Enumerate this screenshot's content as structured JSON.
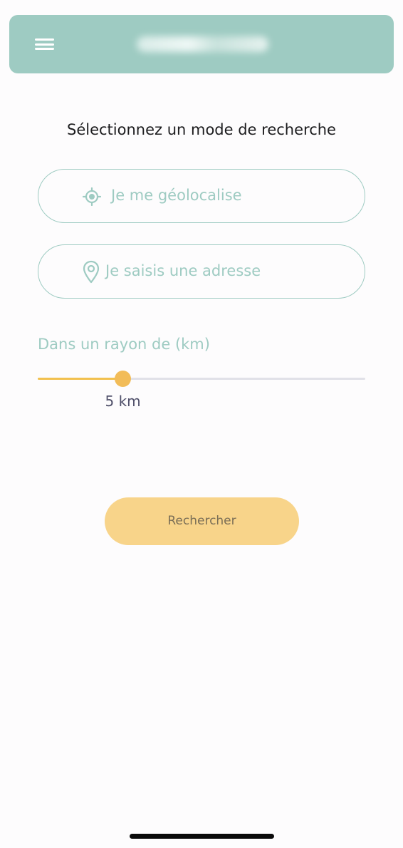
{
  "header": {
    "menu_icon": "hamburger-menu-icon",
    "logo": "blurred-logo",
    "background_color": "#9ecbc2"
  },
  "title": "Sélectionnez un mode de recherche",
  "options": {
    "geolocate": {
      "label": "Je me géolocalise",
      "icon": "crosshair-icon"
    },
    "address": {
      "label": "Je saisis une adresse",
      "icon": "map-pin-icon"
    }
  },
  "radius": {
    "label": "Dans un rayon de (km)",
    "value_label": "5 km",
    "value_fraction": 0.26
  },
  "search_button": {
    "label": "Rechercher",
    "color": "#f8d48a"
  },
  "colors": {
    "accent": "#9ecbc2",
    "slider": "#f2bc58"
  }
}
